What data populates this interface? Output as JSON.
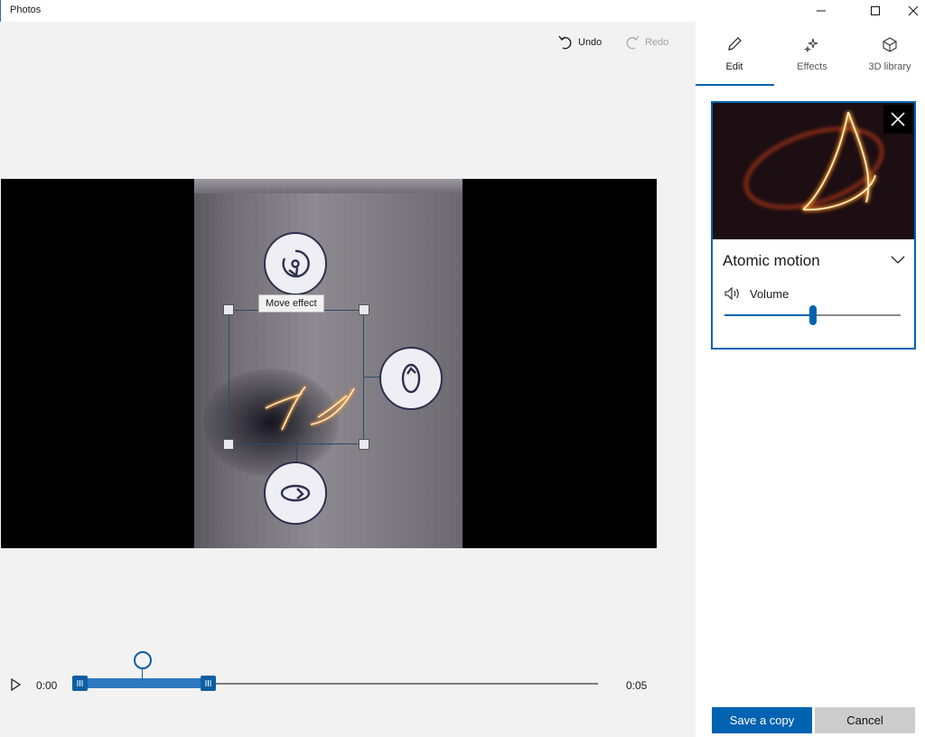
{
  "window": {
    "title": "Photos"
  },
  "toolbar": {
    "undo_label": "Undo",
    "redo_label": "Redo"
  },
  "stage": {
    "tooltip": "Move effect"
  },
  "timeline": {
    "current_time": "0:00",
    "end_time": "0:05"
  },
  "side": {
    "tabs": [
      {
        "label": "Edit",
        "icon": "pencil-icon",
        "selected": true
      },
      {
        "label": "Effects",
        "icon": "sparkle-icon",
        "selected": false
      },
      {
        "label": "3D library",
        "icon": "cube-icon",
        "selected": false
      }
    ],
    "effect": {
      "name": "Atomic motion",
      "volume_label": "Volume",
      "volume_level": 0.5
    },
    "save_label": "Save a copy",
    "cancel_label": "Cancel"
  },
  "colors": {
    "accent": "#0063b1",
    "timeline_fill": "#2e79c0",
    "selection": "#2a4b6a"
  }
}
